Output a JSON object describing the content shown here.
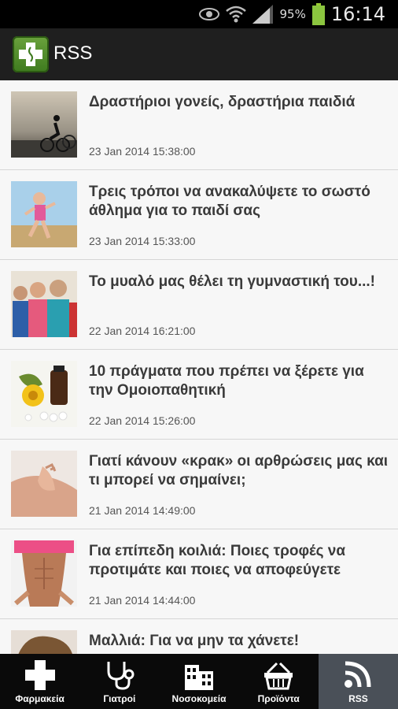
{
  "status_bar": {
    "battery_percent": "95%",
    "time": "16:14"
  },
  "action_bar": {
    "title": "RSS",
    "app_icon": "pharmacy-cross-icon"
  },
  "feed": [
    {
      "title": "Δραστήριοι γονείς, δραστήρια παιδιά",
      "date": "23 Jan 2014 15:38:00",
      "thumbnail": "cyclists-sunset"
    },
    {
      "title": "Τρεις τρόποι να ανακαλύψετε το σωστό άθλημα για το παιδί σας",
      "date": "23 Jan 2014 15:33:00",
      "thumbnail": "running-girl"
    },
    {
      "title": "Το μυαλό μας θέλει τη γυμναστική του...!",
      "date": "22 Jan 2014 16:21:00",
      "thumbnail": "gym-class"
    },
    {
      "title": "10 πράγματα που πρέπει να ξέρετε για την Ομοιοπαθητική",
      "date": "22 Jan 2014 15:26:00",
      "thumbnail": "homeopathy-flower"
    },
    {
      "title": "Γιατί κάνουν «κρακ» οι αρθρώσεις μας και τι μπορεί να σημαίνει;",
      "date": "21 Jan 2014 14:49:00",
      "thumbnail": "shoulder-joint"
    },
    {
      "title": "Για επίπεδη κοιλιά: Ποιες τροφές να προτιμάτε και ποιες να αποφεύγετε",
      "date": "21 Jan 2014 14:44:00",
      "thumbnail": "flat-belly"
    },
    {
      "title": "Μαλλιά: Για να μην τα χάνετε!",
      "date": "",
      "thumbnail": "hair"
    }
  ],
  "tabs": [
    {
      "label": "Φαρμακεία",
      "icon": "cross-icon",
      "active": false
    },
    {
      "label": "Γιατροί",
      "icon": "stethoscope-icon",
      "active": false
    },
    {
      "label": "Νοσοκομεία",
      "icon": "hospital-building-icon",
      "active": false
    },
    {
      "label": "Προϊόντα",
      "icon": "basket-icon",
      "active": false
    },
    {
      "label": "RSS",
      "icon": "rss-icon",
      "active": true
    }
  ]
}
